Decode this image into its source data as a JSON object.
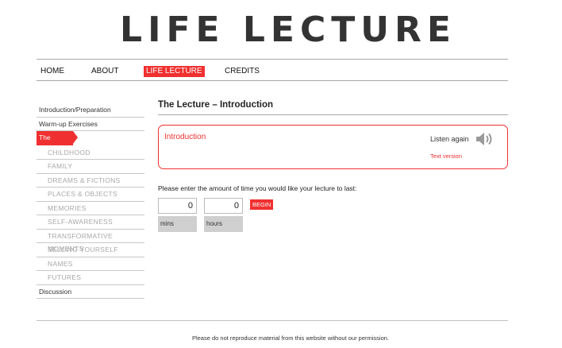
{
  "site": {
    "title": "LIFE LECTURE"
  },
  "topnav": {
    "items": [
      "HOME",
      "ABOUT",
      "LIFE LECTURE",
      "CREDITS"
    ],
    "active": "LIFE LECTURE"
  },
  "sidebar": {
    "items": [
      "Introduction/Preparation",
      "Warm-up Exercises",
      "The Lecture",
      "CHILDHOOD",
      "FAMILY",
      "DREAMS & FICTIONS",
      "PLACES & OBJECTS",
      "MEMORIES",
      "SELF-AWARENESS",
      "TRANSFORMATIVE MOMENTS",
      "SELLING YOURSELF",
      "NAMES",
      "FUTURES",
      "Discussion"
    ],
    "active": "The Lecture"
  },
  "main": {
    "heading": "The Lecture – Introduction",
    "intro": {
      "title": "Introduction",
      "listen_label": "Listen again",
      "text_version": "Text version",
      "speaker_icon": "speaker-icon"
    },
    "prompt": "Please enter the amount of time you would like your lecture to last:",
    "mins": {
      "value": "0",
      "label": "mins"
    },
    "hours": {
      "value": "0",
      "label": "hours"
    },
    "begin_label": "BEGIN"
  },
  "footer": {
    "text": "Please do not reproduce material from this website without our permission."
  },
  "colors": {
    "accent": "#f03030",
    "title": "#333333",
    "muted": "#a8a8a8"
  }
}
